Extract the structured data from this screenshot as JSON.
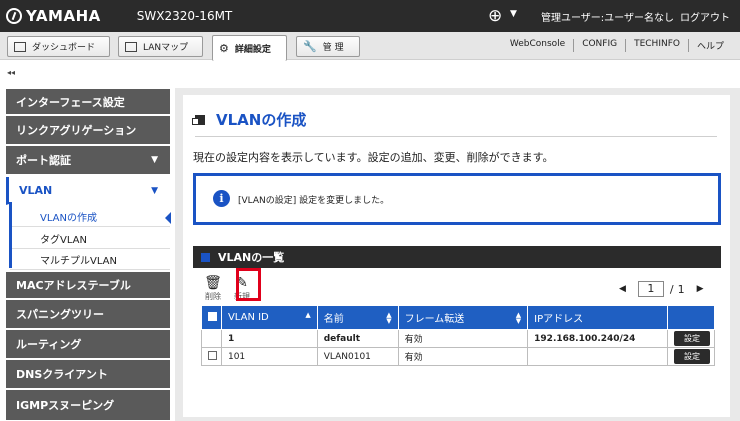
{
  "header": {
    "brand": "YAMAHA",
    "model": "SWX2320-16MT",
    "user": "管理ユーザー:ユーザー名なし",
    "logout": "ログアウト"
  },
  "nav": {
    "tabs": [
      {
        "label": "ダッシュボード"
      },
      {
        "label": "LANマップ"
      },
      {
        "label": "詳細設定"
      },
      {
        "label": "管 理"
      }
    ],
    "links": [
      "WebConsole",
      "CONFIG",
      "TECHINFO",
      "ヘルプ"
    ],
    "collapse": "◂◂"
  },
  "sidebar": {
    "items": [
      {
        "label": "インターフェース設定"
      },
      {
        "label": "リンクアグリゲーション"
      },
      {
        "label": "ポート認証"
      },
      {
        "label": "VLAN"
      },
      {
        "label": "MACアドレステーブル"
      },
      {
        "label": "スパニングツリー"
      },
      {
        "label": "ルーティング"
      },
      {
        "label": "DNSクライアント"
      },
      {
        "label": "IGMPスヌーピング"
      }
    ],
    "vlan_sub": [
      {
        "label": "VLANの作成"
      },
      {
        "label": "タグVLAN"
      },
      {
        "label": "マルチプルVLAN"
      }
    ]
  },
  "main": {
    "title": "VLANの作成",
    "description": "現在の設定内容を表示しています。設定の追加、変更、削除ができます。",
    "notice": "[VLANの設定] 設定を変更しました。",
    "list_title": "VLANの一覧",
    "toolbar": {
      "delete": "削除",
      "new": "新規"
    },
    "pager": {
      "current": "1",
      "separator": "/",
      "total": "1"
    },
    "table": {
      "headers": [
        "VLAN ID",
        "名前",
        "フレーム転送",
        "IPアドレス"
      ],
      "rows": [
        {
          "id": "1",
          "name": "default",
          "forwarding": "有効",
          "ip": "192.168.100.240/24",
          "action": "設定"
        },
        {
          "id": "101",
          "name": "VLAN0101",
          "forwarding": "有効",
          "ip": "",
          "action": "設定"
        }
      ]
    }
  }
}
